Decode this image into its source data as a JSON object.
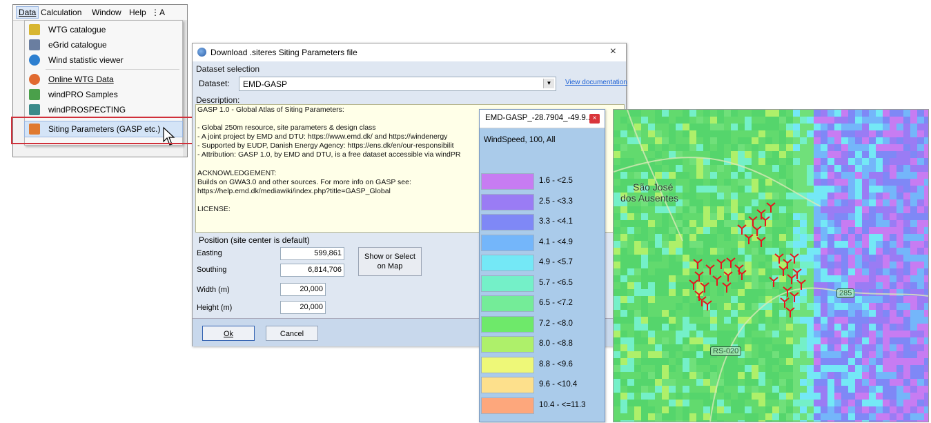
{
  "menu": {
    "bar": [
      "Data",
      "Calculation",
      "Window",
      "Help",
      "⋮",
      "A"
    ],
    "items": [
      {
        "label": "WTG catalogue",
        "icon": "wtg-catalogue-icon",
        "color": "#d8b630"
      },
      {
        "label": "eGrid catalogue",
        "icon": "egrid-catalogue-icon",
        "color": "#6a7ea0"
      },
      {
        "label": "Wind statistic viewer",
        "icon": "wind-statistic-icon",
        "color": "#2d7fd0"
      },
      {
        "label": "Online WTG Data",
        "icon": "online-wtg-icon",
        "color": "#e06a30"
      },
      {
        "label": "windPRO Samples",
        "icon": "samples-icon",
        "color": "#4aa04a"
      },
      {
        "label": "windPROSPECTING",
        "icon": "prospecting-icon",
        "color": "#3a8a8a"
      },
      {
        "label": "Siting Parameters (GASP etc.)",
        "icon": "siting-parameters-icon",
        "color": "#e07a30"
      }
    ]
  },
  "dialog": {
    "title": "Download .siteres Siting Parameters file",
    "close_glyph": "×",
    "dataset_section": "Dataset selection",
    "dataset_label": "Dataset:",
    "dataset_value": "EMD-GASP",
    "view_doc": "View documentation",
    "description_label": "Description:",
    "description_lines": [
      "GASP 1.0 - Global Atlas of Siting Parameters:",
      "",
      "- Global 250m resource, site parameters & design class",
      "- A joint project by EMD and DTU: https://www.emd.dk/ and https://windenergy",
      "- Supported by EUDP, Danish Energy Agency: https://ens.dk/en/our-responsibilit",
      "- Attribution: GASP 1.0, by EMD and DTU, is a free dataset accessible via windPR",
      "",
      "ACKNOWLEDGEMENT:",
      "Builds on GWA3.0 and other sources. For more info on GASP see:",
      "https://help.emd.dk/mediawiki/index.php?title=GASP_Global",
      "",
      "LICENSE:"
    ],
    "position_section": "Position (site center is default)",
    "easting_label": "Easting",
    "easting_value": "599,861",
    "southing_label": "Southing",
    "southing_value": "6,814,706",
    "width_label": "Width (m)",
    "width_value": "20,000",
    "height_label": "Height (m)",
    "height_value": "20,000",
    "show_select_line1": "Show or Select",
    "show_select_line2": "on Map",
    "ok": "Ok",
    "cancel": "Cancel"
  },
  "legend": {
    "title": "EMD-GASP_-28.7904_-49.9...",
    "close_glyph": "×",
    "subtitle": "WindSpeed, 100, All",
    "entries": [
      {
        "range": "1.6 - <2.5",
        "color": "#c77cf2"
      },
      {
        "range": "2.5 - <3.3",
        "color": "#9a7cf4"
      },
      {
        "range": "3.3 - <4.1",
        "color": "#7f88f6"
      },
      {
        "range": "4.1 - <4.9",
        "color": "#74b6fa"
      },
      {
        "range": "4.9 - <5.7",
        "color": "#74e8f6"
      },
      {
        "range": "5.7 - <6.5",
        "color": "#74f0c8"
      },
      {
        "range": "6.5 - <7.2",
        "color": "#74ec98"
      },
      {
        "range": "7.2 - <8.0",
        "color": "#6ee96a"
      },
      {
        "range": "8.0 - <8.8",
        "color": "#aef06a"
      },
      {
        "range": "8.8 - <9.6",
        "color": "#eef878"
      },
      {
        "range": "9.6 - <10.4",
        "color": "#fde08c"
      },
      {
        "range": "10.4 - <=11.3",
        "color": "#fda77c"
      }
    ]
  },
  "map": {
    "place_line1": "São José",
    "place_line2": "dos Ausentes",
    "road_1": "285",
    "road_2": "RS-020"
  }
}
